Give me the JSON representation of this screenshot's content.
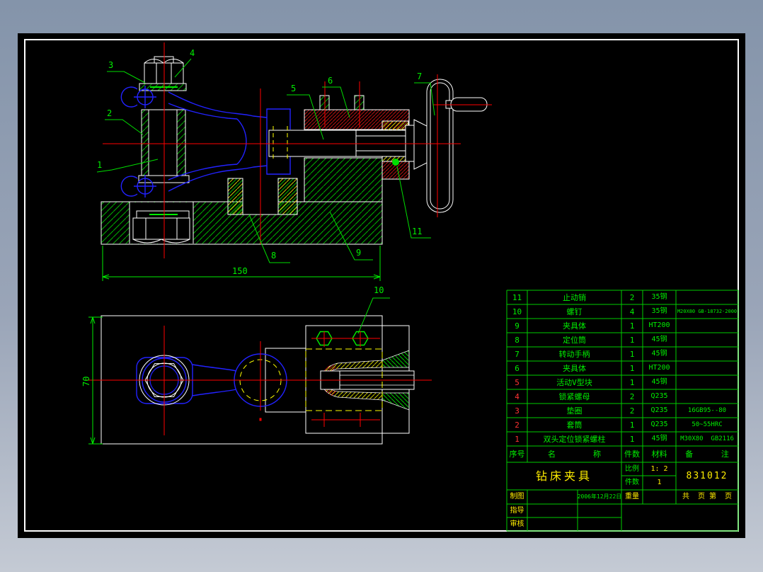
{
  "title_block": {
    "title": "钻床夹具",
    "scale_label": "比例",
    "scale_value": "1: 2",
    "qty_label": "件数",
    "qty_value": "1",
    "drawing_no": "831012",
    "drawn_label": "制图",
    "drawn_date": "2006年12月22日",
    "weight_label": "重量",
    "pages_label": "共  页 第  页",
    "advisor_label": "指导",
    "checker_label": "审核"
  },
  "parts_table": {
    "headers": {
      "no": "序号",
      "name": "名        称",
      "qty": "件数",
      "material": "材料",
      "remark": "备      注"
    },
    "rows": [
      {
        "no": "11",
        "name": "止动销",
        "qty": "2",
        "material": "35钢",
        "remark": ""
      },
      {
        "no": "10",
        "name": "螺钉",
        "qty": "4",
        "material": "35钢",
        "remark": "M20X80 GB-18732-2000"
      },
      {
        "no": "9",
        "name": "夹具体",
        "qty": "1",
        "material": "HT200",
        "remark": ""
      },
      {
        "no": "8",
        "name": "定位筒",
        "qty": "1",
        "material": "45钢",
        "remark": ""
      },
      {
        "no": "7",
        "name": "转动手柄",
        "qty": "1",
        "material": "45钢",
        "remark": ""
      },
      {
        "no": "6",
        "name": "夹具体",
        "qty": "1",
        "material": "HT200",
        "remark": ""
      },
      {
        "no": "5",
        "name": "活动V型块",
        "qty": "1",
        "material": "45钢",
        "remark": ""
      },
      {
        "no": "4",
        "name": "锁紧螺母",
        "qty": "2",
        "material": "Q235",
        "remark": ""
      },
      {
        "no": "3",
        "name": "垫圈",
        "qty": "2",
        "material": "Q235",
        "remark": "16GB95--80"
      },
      {
        "no": "2",
        "name": "套筒",
        "qty": "1",
        "material": "Q235",
        "remark": "50~55HRC"
      },
      {
        "no": "1",
        "name": "双头定位锁紧螺柱",
        "qty": "1",
        "material": "45钢",
        "remark": "M30X80  GB2116"
      }
    ]
  },
  "callouts": [
    "1",
    "2",
    "3",
    "4",
    "5",
    "6",
    "7",
    "8",
    "9",
    "10",
    "11"
  ],
  "dimensions": {
    "overall_length": "150",
    "overall_width": "70"
  },
  "colors": {
    "outline": "#ffffff",
    "annotation": "#00ee00",
    "centerline": "#ff0000",
    "hidden_line": "#ffff00",
    "part_outline": "#2222ff",
    "hatch_green": "#00b400",
    "hatch_red": "#bb1111",
    "hatch_yellow": "#cccc00",
    "background_top": "#8494aa",
    "background_bottom": "#c4cad4"
  }
}
